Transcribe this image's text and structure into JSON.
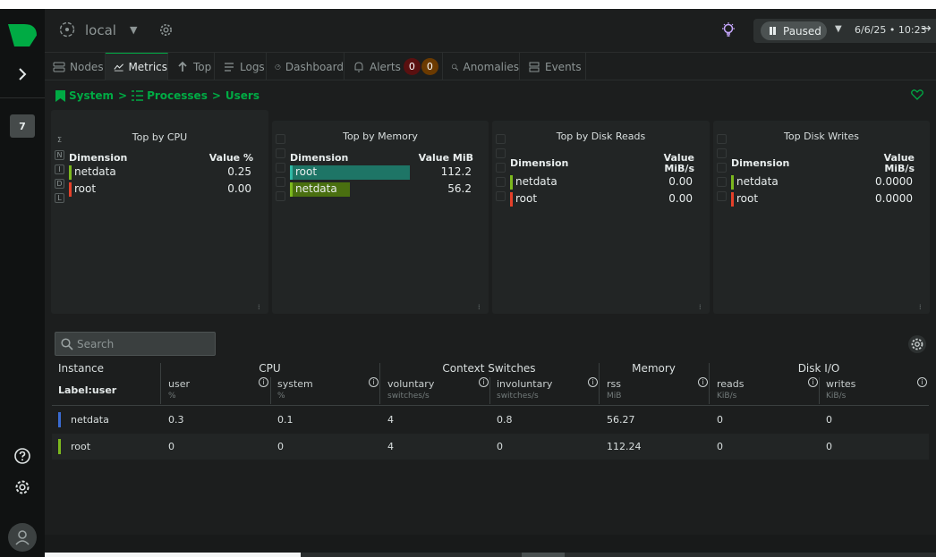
{
  "header": {
    "room": "local",
    "pause_label": "Paused",
    "datetime": "6/6/25 • 10:23",
    "arrow": "→"
  },
  "sidebar": {
    "space_badge": "7"
  },
  "tabs": [
    {
      "label": "Nodes"
    },
    {
      "label": "Metrics"
    },
    {
      "label": "Top"
    },
    {
      "label": "Logs"
    },
    {
      "label": "Dashboard"
    },
    {
      "label": "Alerts",
      "critical": "0",
      "warning": "0"
    },
    {
      "label": "Anomalies"
    },
    {
      "label": "Events"
    }
  ],
  "breadcrumb": {
    "a": "System",
    "sep1": ">",
    "b": "Processes",
    "sep2": ">",
    "c": "Users"
  },
  "panels": {
    "cpu": {
      "title": "Top by CPU",
      "dim": "Dimension",
      "val": "Value %",
      "rows": [
        {
          "name": "netdata",
          "value": "0.25"
        },
        {
          "name": "root",
          "value": "0.00"
        }
      ]
    },
    "memory": {
      "title": "Top by Memory",
      "dim": "Dimension",
      "val": "Value MiB",
      "rows": [
        {
          "name": "root",
          "value": "112.2"
        },
        {
          "name": "netdata",
          "value": "56.2"
        }
      ]
    },
    "disk_reads": {
      "title": "Top by Disk Reads",
      "dim": "Dimension",
      "val1": "Value",
      "val2": "MiB/s",
      "rows": [
        {
          "name": "netdata",
          "value": "0.00"
        },
        {
          "name": "root",
          "value": "0.00"
        }
      ]
    },
    "disk_writes": {
      "title": "Top Disk Writes",
      "dim": "Dimension",
      "val1": "Value",
      "val2": "MiB/s",
      "rows": [
        {
          "name": "netdata",
          "value": "0.0000"
        },
        {
          "name": "root",
          "value": "0.0000"
        }
      ]
    }
  },
  "panel_icon_letters": {
    "n": "N",
    "i": "I",
    "d": "D",
    "l": "L",
    "sigma": "Σ"
  },
  "search": {
    "placeholder": "Search"
  },
  "table": {
    "instance": "Instance",
    "label_user": "Label:user",
    "groups": {
      "cpu": "CPU",
      "ctx": "Context Switches",
      "mem": "Memory",
      "disk": "Disk I/O"
    },
    "cols": {
      "user": "user",
      "user_u": "%",
      "system": "system",
      "system_u": "%",
      "voluntary": "voluntary",
      "voluntary_u": "switches/s",
      "involuntary": "involuntary",
      "involuntary_u": "switches/s",
      "rss": "rss",
      "rss_u": "MiB",
      "reads": "reads",
      "reads_u": "KiB/s",
      "writes": "writes",
      "writes_u": "KiB/s"
    },
    "rows": [
      {
        "instance": "netdata",
        "user": "0.3",
        "system": "0.1",
        "voluntary": "4",
        "involuntary": "0.8",
        "rss": "56.27",
        "reads": "0",
        "writes": "0"
      },
      {
        "instance": "root",
        "user": "0",
        "system": "0",
        "voluntary": "4",
        "involuntary": "0",
        "rss": "112.24",
        "reads": "0",
        "writes": "0"
      }
    ]
  },
  "colors": {
    "green": "#00ab44",
    "lime": "#7cb81e",
    "red": "#e5402a",
    "blue": "#3a6bd1",
    "teal": "#1e8a7a"
  }
}
